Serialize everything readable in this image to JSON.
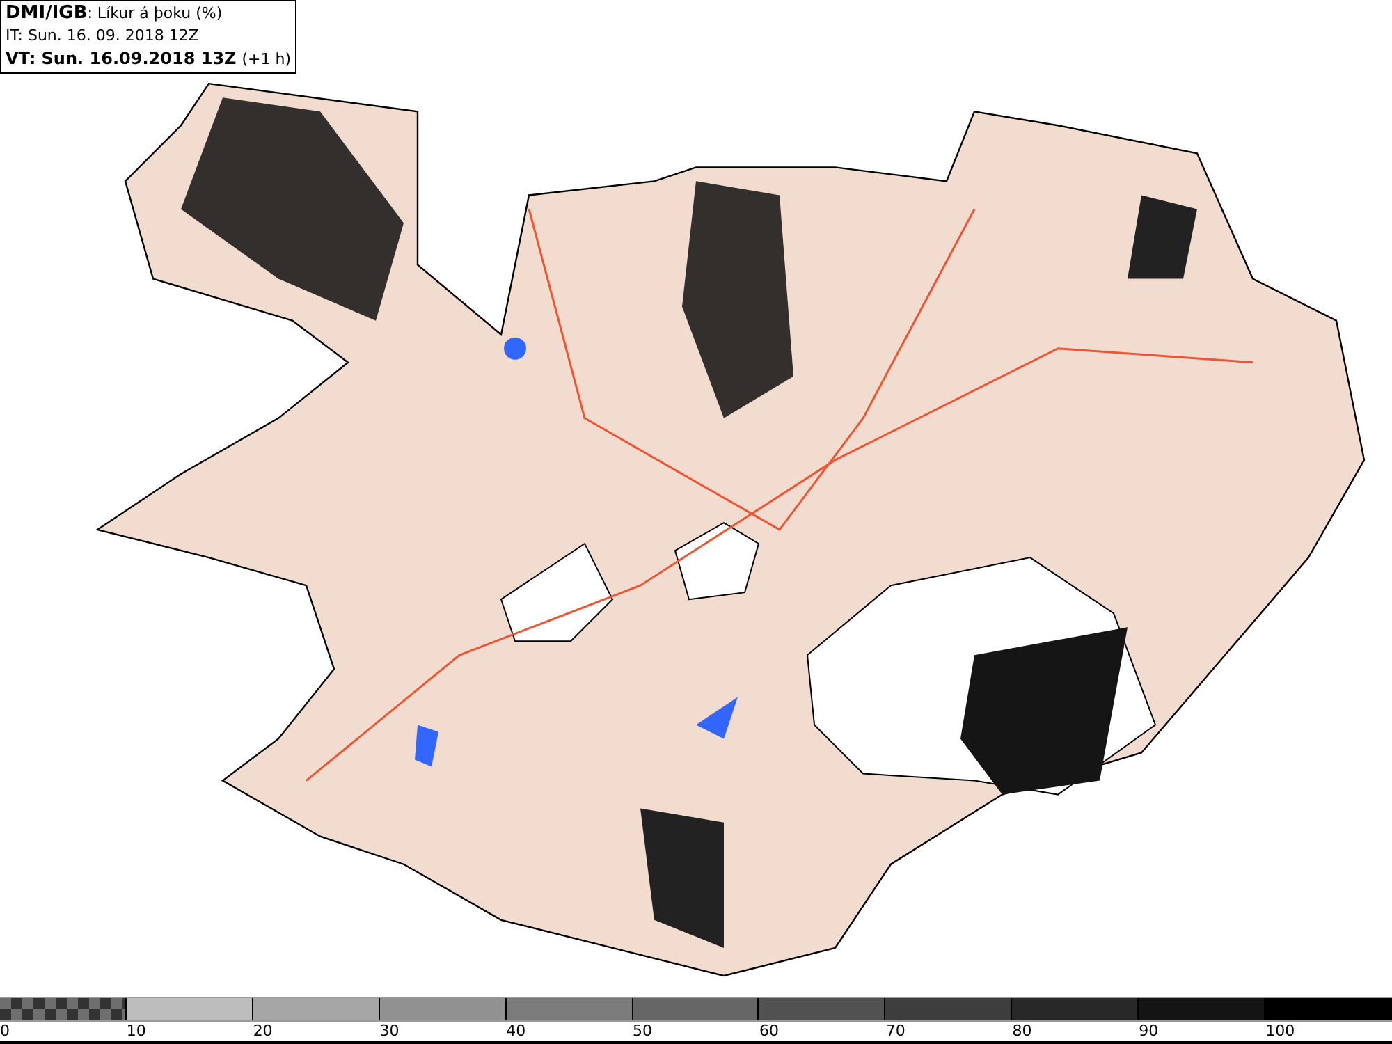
{
  "header": {
    "source": "DMI/IGB",
    "product": " : Líkur á þoku (%)",
    "initial_time": "IT: Sun. 16. 09. 2018 12Z",
    "valid_time": "VT: Sun. 16.09.2018 13Z",
    "lead": "(+1 h)"
  },
  "legend": {
    "segments": [
      {
        "kind": "checker",
        "color": "#6e6e6e"
      },
      {
        "kind": "solid",
        "color": "#bdbdbd"
      },
      {
        "kind": "solid",
        "color": "#a6a6a6"
      },
      {
        "kind": "solid",
        "color": "#919191"
      },
      {
        "kind": "solid",
        "color": "#7b7b7b"
      },
      {
        "kind": "solid",
        "color": "#666666"
      },
      {
        "kind": "solid",
        "color": "#515151"
      },
      {
        "kind": "solid",
        "color": "#3d3d3d"
      },
      {
        "kind": "solid",
        "color": "#282828"
      },
      {
        "kind": "solid",
        "color": "#141414"
      },
      {
        "kind": "solid",
        "color": "#000000"
      }
    ],
    "labels": [
      "0",
      "10",
      "20",
      "30",
      "40",
      "50",
      "60",
      "70",
      "80",
      "90",
      "100"
    ]
  }
}
